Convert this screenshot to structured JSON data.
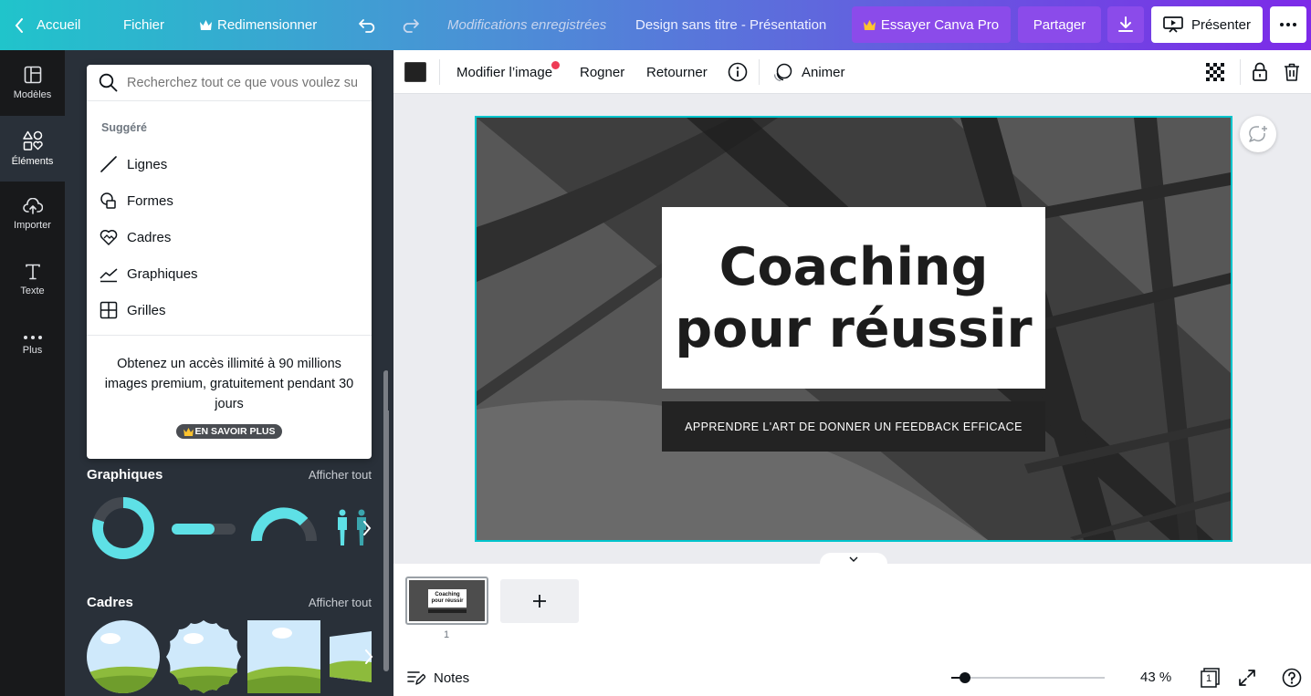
{
  "topbar": {
    "home_label": "Accueil",
    "file_label": "Fichier",
    "resize_label": "Redimensionner",
    "status_text": "Modifications enregistrées",
    "doc_title": "Design sans titre - Présentation",
    "pro_label": "Essayer Canva Pro",
    "share_label": "Partager",
    "present_label": "Présenter"
  },
  "rail": {
    "items": [
      {
        "label": "Modèles",
        "icon": "templates-icon"
      },
      {
        "label": "Éléments",
        "icon": "elements-icon"
      },
      {
        "label": "Importer",
        "icon": "upload-icon"
      },
      {
        "label": "Texte",
        "icon": "text-icon"
      },
      {
        "label": "Plus",
        "icon": "more-icon"
      }
    ]
  },
  "search": {
    "placeholder": "Recherchez tout ce que vous voulez sur Canva"
  },
  "suggest": {
    "heading": "Suggéré",
    "items": [
      {
        "label": "Lignes",
        "icon": "line-icon"
      },
      {
        "label": "Formes",
        "icon": "shapes-icon"
      },
      {
        "label": "Cadres",
        "icon": "frames-icon"
      },
      {
        "label": "Graphiques",
        "icon": "chart-icon"
      },
      {
        "label": "Grilles",
        "icon": "grid-icon"
      }
    ],
    "promo_text": "Obtenez un accès illimité à 90 millions images premium, gratuitement pendant 30 jours",
    "promo_button": "EN SAVOIR PLUS"
  },
  "sections": {
    "charts_title": "Graphiques",
    "charts_link": "Afficher tout",
    "frames_title": "Cadres",
    "frames_link": "Afficher tout"
  },
  "toolbar": {
    "edit_image": "Modifier l’image",
    "crop": "Rogner",
    "flip": "Retourner",
    "animate": "Animer",
    "swatch_color": "#222222"
  },
  "slide": {
    "title_line1": "Coaching",
    "title_line2": "pour réussir",
    "subtitle": "APPRENDRE L'ART DE DONNER UN FEEDBACK EFFICACE"
  },
  "pages": {
    "thumb_title1": "Coaching",
    "thumb_title2": "pour réussir",
    "page_number": "1"
  },
  "footer": {
    "notes_label": "Notes",
    "zoom_label": "43 %",
    "zoom_value": 0.43,
    "page_count": "1"
  },
  "colors": {
    "accent_purple": "#7d2ae8",
    "teal": "#00c4cc",
    "chart_cyan": "#5ee0e6"
  }
}
